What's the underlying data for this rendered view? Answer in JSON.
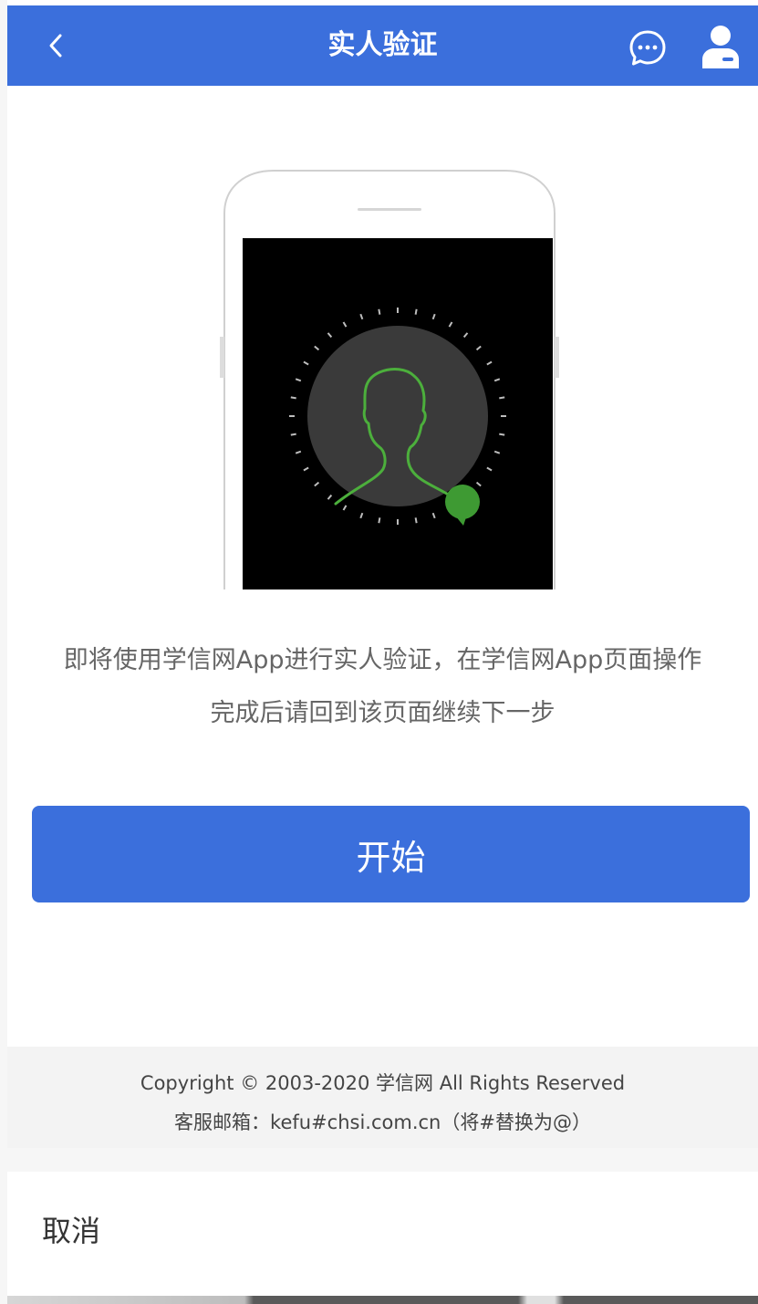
{
  "header": {
    "title": "实人验证",
    "back_icon": "chevron-left-icon",
    "chat_icon": "chat-bubble-icon",
    "user_icon": "user-icon"
  },
  "main": {
    "illustration": "phone-face-scan",
    "description_line1": "即将使用学信网App进行实人验证，在学信网App页面操作",
    "description_line2": "完成后请回到该页面继续下一步",
    "start_button_label": "开始"
  },
  "footer": {
    "copyright": "Copyright © 2003-2020 学信网 All Rights Reserved",
    "service_email": "客服邮箱：kefu#chsi.com.cn（将#替换为@）"
  },
  "action_sheet": {
    "cancel_label": "取消"
  },
  "colors": {
    "primary": "#3b6fdc",
    "face_outline": "#4caf3c",
    "background": "#ffffff"
  }
}
